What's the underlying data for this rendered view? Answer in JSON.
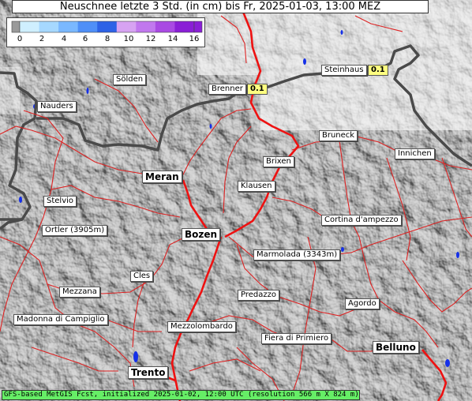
{
  "title": "Neuschnee letzte 3 Std. (in cm) bis Fr, 2025-01-03, 13:00 MEZ",
  "legend": {
    "ticks": [
      "0",
      "2",
      "4",
      "6",
      "8",
      "10",
      "12",
      "14",
      "16"
    ],
    "colors": [
      "#cfefff",
      "#a6d8ff",
      "#7ab8ff",
      "#4f8ff7",
      "#2d62e6",
      "#d7a3f2",
      "#c178ee",
      "#a94ae3",
      "#8a1fd6"
    ]
  },
  "places": [
    {
      "id": "soelden",
      "name": "Sölden"
    },
    {
      "id": "nauders",
      "name": "Nauders"
    },
    {
      "id": "brenner",
      "name": "Brenner",
      "value": "0.1"
    },
    {
      "id": "steinhaus",
      "name": "Steinhaus",
      "value": "0.1"
    },
    {
      "id": "bruneck",
      "name": "Bruneck"
    },
    {
      "id": "innichen",
      "name": "Innichen"
    },
    {
      "id": "meran",
      "name": "Meran"
    },
    {
      "id": "brixen",
      "name": "Brixen"
    },
    {
      "id": "klausen",
      "name": "Klausen"
    },
    {
      "id": "stelvio",
      "name": "Stelvio"
    },
    {
      "id": "ortler",
      "name": "Ortler (3905m)"
    },
    {
      "id": "bozen",
      "name": "Bozen"
    },
    {
      "id": "cortina",
      "name": "Cortina d'ampezzo"
    },
    {
      "id": "marmolada",
      "name": "Marmolada (3343m)"
    },
    {
      "id": "cles",
      "name": "Cles"
    },
    {
      "id": "mezzana",
      "name": "Mezzana"
    },
    {
      "id": "predazzo",
      "name": "Predazzo"
    },
    {
      "id": "agordo",
      "name": "Agordo"
    },
    {
      "id": "madonna",
      "name": "Madonna di Campiglio"
    },
    {
      "id": "mezzolombardo",
      "name": "Mezzolombardo"
    },
    {
      "id": "fiera",
      "name": "Fiera di Primiero"
    },
    {
      "id": "belluno",
      "name": "Belluno"
    },
    {
      "id": "trento",
      "name": "Trento"
    }
  ],
  "footer": "GFS-based MetGIS Fcst, initialized 2025-01-02, 12:00 UTC  (resolution 566 m X 824 m)"
}
